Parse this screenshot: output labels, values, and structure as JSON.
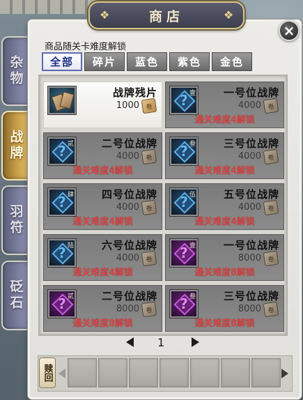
{
  "shop": {
    "title": "商店",
    "unlock_hint": "商品随关卡难度解锁",
    "close_label": "×"
  },
  "side_tabs": [
    {
      "label": "杂物",
      "active": false
    },
    {
      "label": "战牌",
      "active": true
    },
    {
      "label": "羽符",
      "active": false
    },
    {
      "label": "砭石",
      "active": false
    }
  ],
  "filter_tabs": [
    {
      "label": "全部",
      "active": true
    },
    {
      "label": "碎片",
      "active": false
    },
    {
      "label": "蓝色",
      "active": false
    },
    {
      "label": "紫色",
      "active": false
    },
    {
      "label": "金色",
      "active": false
    }
  ],
  "items": [
    {
      "name": "战牌残片",
      "price": "1000",
      "icon": "card-fragment-icon",
      "pos_char": "",
      "rarity": "fragment",
      "requirement": "",
      "owned": true
    },
    {
      "name": "一号位战牌",
      "price": "4000",
      "icon": "blue-card-icon",
      "pos_char": "壹",
      "rarity": "blue",
      "requirement": "通关难度4解锁",
      "owned": false
    },
    {
      "name": "二号位战牌",
      "price": "4000",
      "icon": "blue-card-icon",
      "pos_char": "贰",
      "rarity": "blue",
      "requirement": "通关难度4解锁",
      "owned": false
    },
    {
      "name": "三号位战牌",
      "price": "4000",
      "icon": "blue-card-icon",
      "pos_char": "叁",
      "rarity": "blue",
      "requirement": "通关难度4解锁",
      "owned": false
    },
    {
      "name": "四号位战牌",
      "price": "4000",
      "icon": "blue-card-icon",
      "pos_char": "肆",
      "rarity": "blue",
      "requirement": "通关难度4解锁",
      "owned": false
    },
    {
      "name": "五号位战牌",
      "price": "4000",
      "icon": "blue-card-icon",
      "pos_char": "伍",
      "rarity": "blue",
      "requirement": "通关难度4解锁",
      "owned": false
    },
    {
      "name": "六号位战牌",
      "price": "4000",
      "icon": "blue-card-icon",
      "pos_char": "陆",
      "rarity": "blue",
      "requirement": "通关难度4解锁",
      "owned": false
    },
    {
      "name": "一号位战牌",
      "price": "8000",
      "icon": "purple-card-icon",
      "pos_char": "壹",
      "rarity": "purple",
      "requirement": "通关难度8解锁",
      "owned": false
    },
    {
      "name": "二号位战牌",
      "price": "8000",
      "icon": "purple-card-icon",
      "pos_char": "贰",
      "rarity": "purple",
      "requirement": "通关难度8解锁",
      "owned": false
    },
    {
      "name": "三号位战牌",
      "price": "8000",
      "icon": "purple-card-icon",
      "pos_char": "叁",
      "rarity": "purple",
      "requirement": "通关难度8解锁",
      "owned": false
    }
  ],
  "pager": {
    "current_page": "1"
  },
  "buyback": {
    "label": "赎回",
    "slot_count": 7
  },
  "colors": {
    "active_tab_border": "#5e6ab0",
    "unlock_text": "#ff4242",
    "side_tab_active": "#c79b45",
    "side_tab_inactive": "#7c80a0"
  }
}
